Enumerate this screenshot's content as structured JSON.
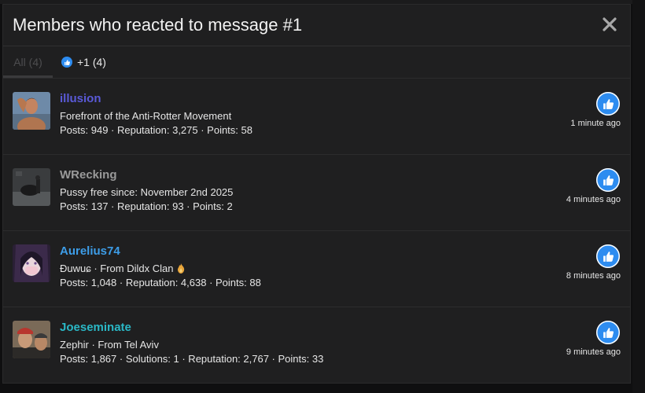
{
  "modal": {
    "title": "Members who reacted to message #1"
  },
  "tabs": {
    "all": "All (4)",
    "like": "+1 (4)"
  },
  "colors": {
    "accent_blue": "#2d8cf0",
    "user_illusion": "#5a5ad8",
    "user_wrecking": "#9a9a9a",
    "user_aurelius": "#3d9de8",
    "user_joeseminate": "#2ab8c6"
  },
  "members": [
    {
      "name": "illusion",
      "title": "Forefront of the Anti-Rotter Movement",
      "stats": "Posts: 949 · Reputation: 3,275 · Points: 58",
      "time": "1 minute ago",
      "reaction_icon": "thumbs-up-icon"
    },
    {
      "name": "WRecking",
      "title": "Pussy free since: November 2nd 2025",
      "stats": "Posts: 137 · Reputation: 93 · Points: 2",
      "time": "4 minutes ago",
      "reaction_icon": "thumbs-up-icon"
    },
    {
      "name": "Aurelius74",
      "title": "Ɖuwuɕ · From Dildx Clan",
      "stats": "Posts: 1,048 · Reputation: 4,638 · Points: 88",
      "time": "8 minutes ago",
      "reaction_icon": "thumbs-up-icon"
    },
    {
      "name": "Joeseminate",
      "title": "Zephir · From Tel Aviv",
      "stats": "Posts: 1,867 · Solutions: 1 · Reputation: 2,767 · Points: 33",
      "time": "9 minutes ago",
      "reaction_icon": "thumbs-up-icon"
    }
  ]
}
